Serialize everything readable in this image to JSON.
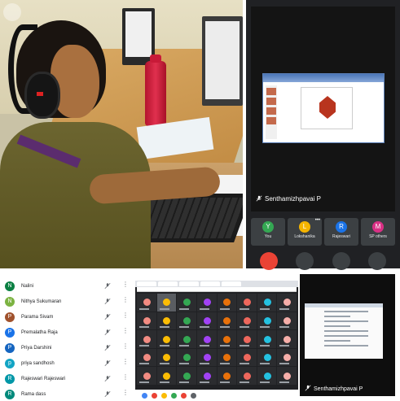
{
  "photo": {},
  "meet_top": {
    "presenter_name": "Senthamizhpavai P",
    "participants": [
      {
        "label": "You",
        "avatar": "Y",
        "color": "#34a853"
      },
      {
        "label": "Lokshanika",
        "avatar": "L",
        "color": "#f4b400"
      },
      {
        "label": "Rajeswari",
        "avatar": "R",
        "color": "#1a73e8"
      },
      {
        "label": "SP others",
        "avatar": "M",
        "color": "#d93085"
      }
    ],
    "more_menu": "•••"
  },
  "participant_list": {
    "rows": [
      {
        "name": "Nalini",
        "avatar": "N",
        "color": "#0b8043"
      },
      {
        "name": "Nithya Sukumaran",
        "avatar": "N",
        "color": "#7cb342"
      },
      {
        "name": "Parama Sivam",
        "avatar": "P",
        "color": "#a0522d"
      },
      {
        "name": "Premalatha Raja",
        "avatar": "P",
        "color": "#1a73e8"
      },
      {
        "name": "Priya Darshini",
        "avatar": "P",
        "color": "#1565c0"
      },
      {
        "name": "priya sandhosh",
        "avatar": "p",
        "color": "#12a4c4"
      },
      {
        "name": "Rajeswari Rajeswari",
        "avatar": "R",
        "color": "#0097a7"
      },
      {
        "name": "Rama dass",
        "avatar": "R",
        "color": "#00897b"
      }
    ],
    "more_icon": "⋮"
  },
  "browser_grid": {
    "avatar_colors": [
      "#f28b82",
      "#fbbc04",
      "#34a853",
      "#a142f4",
      "#e8710a",
      "#ee675c",
      "#24c1e0",
      "#f6aea9"
    ]
  },
  "narrow_panel": {
    "presenter_name": "Senthamizhpavai P"
  }
}
